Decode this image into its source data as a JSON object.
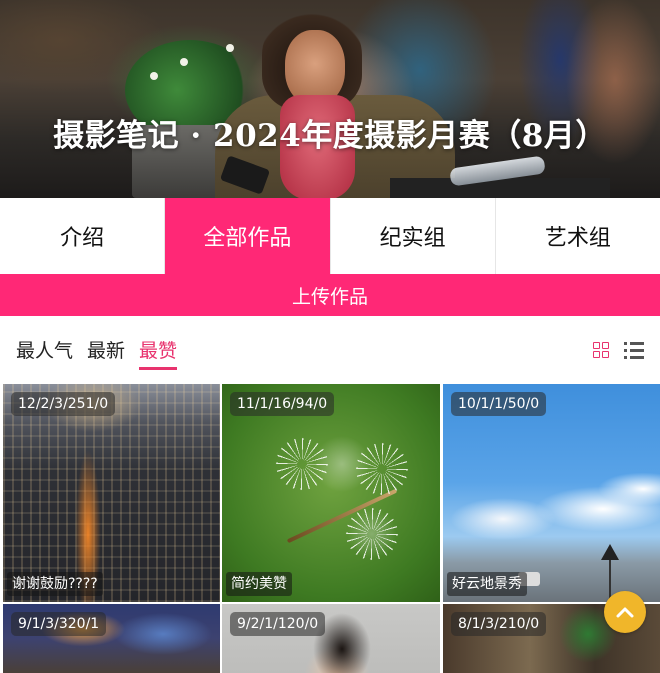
{
  "banner": {
    "title": "摄影笔记 · 2024年度摄影月赛（8月）"
  },
  "tabs": [
    {
      "label": "介绍",
      "active": false
    },
    {
      "label": "全部作品",
      "active": true
    },
    {
      "label": "纪实组",
      "active": false
    },
    {
      "label": "艺术组",
      "active": false
    }
  ],
  "upload": {
    "label": "上传作品"
  },
  "sort": {
    "options": [
      {
        "label": "最人气",
        "active": false
      },
      {
        "label": "最新",
        "active": false
      },
      {
        "label": "最赞",
        "active": true
      }
    ],
    "view_icons": [
      "grid-icon",
      "list-icon"
    ]
  },
  "photos": [
    {
      "stats": "12/2/3/251/0",
      "caption": "谢谢鼓励????"
    },
    {
      "stats": "11/1/16/94/0",
      "caption": "简约美赞"
    },
    {
      "stats": "10/1/1/50/0",
      "caption": "好云地景秀"
    },
    {
      "stats": "9/1/3/320/1",
      "caption": ""
    },
    {
      "stats": "9/2/1/120/0",
      "caption": ""
    },
    {
      "stats": "8/1/3/210/0",
      "caption": ""
    }
  ],
  "colors": {
    "accent": "#ff2876",
    "sort_active": "#e8336e",
    "scroll_top": "#f0b62a"
  },
  "icons": {
    "scroll_top": "chevron-up-icon"
  }
}
